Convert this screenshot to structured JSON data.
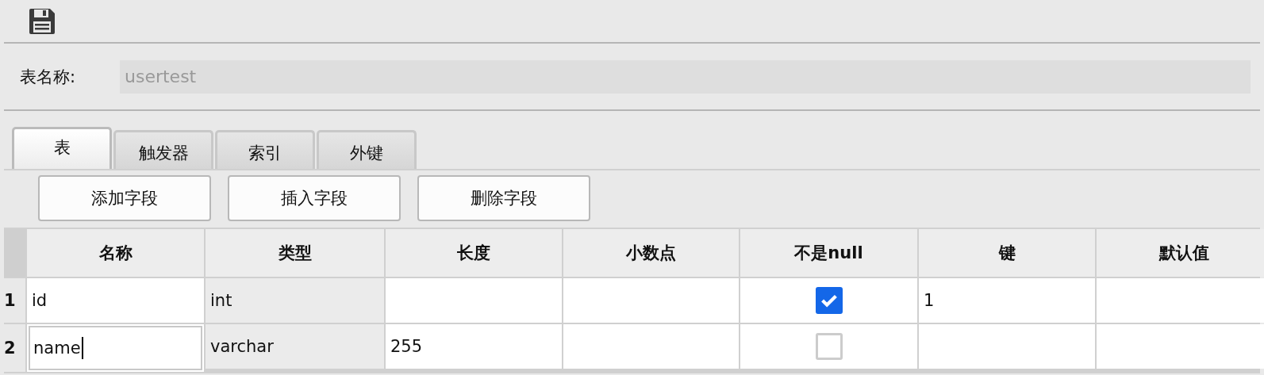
{
  "table_name": {
    "label": "表名称:",
    "value": "usertest"
  },
  "tabs": [
    {
      "label": "表",
      "selected": true
    },
    {
      "label": "触发器",
      "selected": false
    },
    {
      "label": "索引",
      "selected": false
    },
    {
      "label": "外键",
      "selected": false
    }
  ],
  "buttons": [
    "添加字段",
    "插入字段",
    "删除字段"
  ],
  "grid": {
    "columns": [
      "名称",
      "类型",
      "长度",
      "小数点",
      "不是null",
      "键",
      "默认值"
    ],
    "rows": [
      {
        "number": "1",
        "editing": false,
        "name": "id",
        "type": "int",
        "length": "",
        "decimals": "",
        "not_null": true,
        "key": "1",
        "default": ""
      },
      {
        "number": "2",
        "editing": true,
        "name": "name",
        "type": "varchar",
        "length": "255",
        "decimals": "",
        "not_null": false,
        "key": "",
        "default": ""
      }
    ]
  }
}
